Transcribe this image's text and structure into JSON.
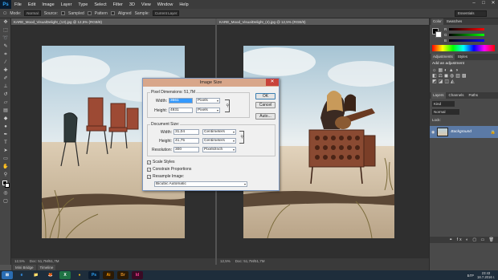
{
  "menu": {
    "logo": "Ps",
    "items": [
      "File",
      "Edit",
      "Image",
      "Layer",
      "Type",
      "Select",
      "Filter",
      "3D",
      "View",
      "Window",
      "Help"
    ]
  },
  "window_controls": {
    "minimize": "–",
    "maximize": "□",
    "close": "✕"
  },
  "options": {
    "mode_label": "Mode:",
    "mode_value": "Normal",
    "source_label": "Source:",
    "sampled": "Sampled",
    "pattern": "Pattern",
    "aligned": "Aligned",
    "sample_label": "Sample:",
    "sample_value": "Current Layer",
    "workspace": "Essentials"
  },
  "doc_left": {
    "tab": "KARE_Mood_VisualDelight_(13).jpg @ 12,5% (RGB/8)",
    "zoom": "12,5%",
    "info": "Doc: 51,7M/51,7M"
  },
  "doc_right": {
    "tab": "KARE_Mood_VisualDelight_(4).jpg @ 12,5% (RGB/8)",
    "zoom": "12,5%",
    "info": "Doc: 51,7M/51,7M"
  },
  "bottom_tabs": [
    "Mini Bridge",
    "Timeline"
  ],
  "panels": {
    "color_tabs": [
      "Color",
      "Swatches"
    ],
    "adj_tabs": [
      "Adjustments",
      "Styles"
    ],
    "adj_title": "Add an adjustment",
    "layer_tabs": [
      "Layers",
      "Channels",
      "Paths"
    ],
    "kind_label": "Kind",
    "blend_mode": "Normal",
    "lock_label": "Lock:",
    "layer_name": "Background",
    "channel_labels": [
      "R",
      "G",
      "B"
    ]
  },
  "dialog": {
    "title": "Image Size",
    "pixel_dimensions_label": "Pixel Dimensions:",
    "pixel_dimensions_value": "51,7M",
    "width_label": "Width:",
    "width_value": "3661",
    "width_unit": "Pixels",
    "height_label": "Height:",
    "height_value": "4931",
    "height_unit": "Pixels",
    "document_size_label": "Document Size:",
    "doc_width_label": "Width:",
    "doc_width_value": "31,04",
    "doc_width_unit": "Centimeters",
    "doc_height_label": "Height:",
    "doc_height_value": "41,75",
    "doc_height_unit": "Centimeters",
    "resolution_label": "Resolution:",
    "resolution_value": "300",
    "resolution_unit": "Pixels/Inch",
    "scale_styles": "Scale Styles",
    "constrain": "Constrain Proportions",
    "resample": "Resample Image:",
    "resample_method": "Bicubic Automatic",
    "ok": "OK",
    "cancel": "Cancel",
    "auto": "Auto..."
  },
  "taskbar": {
    "apps": [
      "e",
      "📁",
      "🦊",
      "X",
      "●",
      "Ps",
      "Ai",
      "Br",
      "Id"
    ],
    "lang": "БГР",
    "time": "23:43",
    "date": "18.7.2016 г."
  }
}
